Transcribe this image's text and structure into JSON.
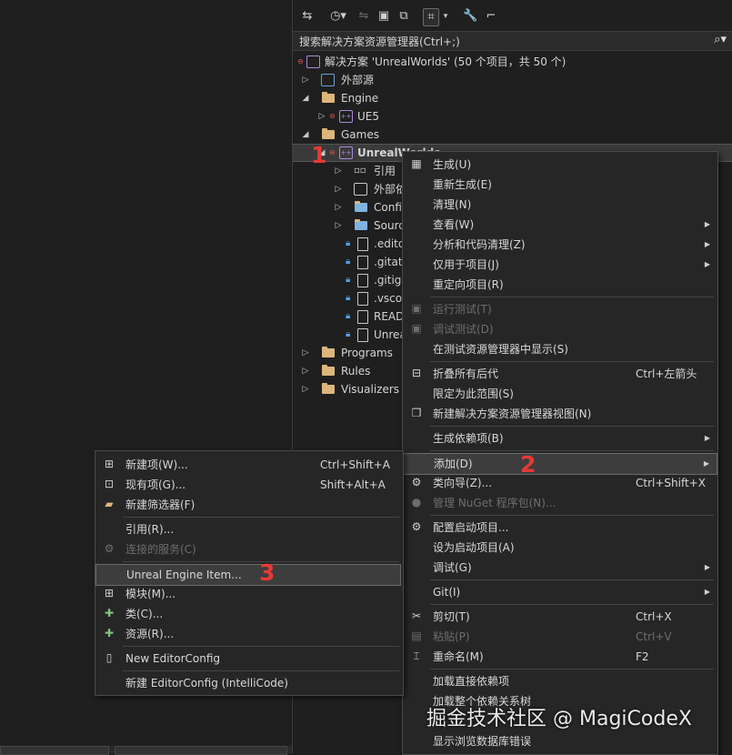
{
  "search": {
    "placeholder": "搜索解决方案资源管理器(Ctrl+;)"
  },
  "solution": {
    "label": "解决方案 'UnrealWorlds' (50 个项目，共 50 个)"
  },
  "tree": {
    "external_sources": "外部源",
    "engine": "Engine",
    "ue5": "UE5",
    "games": "Games",
    "unrealworlds": "UnrealWorlds",
    "references": "引用",
    "external_deps": "外部依",
    "config": "Confi",
    "source": "Sourc",
    "editorconfig": ".edito",
    "gitattributes": ".gitat",
    "gitignore": ".gitig",
    "vscode": ".vsco",
    "readme": "READ",
    "unreal_file": "Unrea",
    "programs": "Programs",
    "rules": "Rules",
    "visualizers": "Visualizers"
  },
  "badges": {
    "b1": "1",
    "b2": "2",
    "b3": "3"
  },
  "context_menu": [
    {
      "label": "生成(U)"
    },
    {
      "label": "重新生成(E)"
    },
    {
      "label": "清理(N)"
    },
    {
      "label": "查看(W)"
    },
    {
      "label": "分析和代码清理(Z)"
    },
    {
      "label": "仅用于项目(J)"
    },
    {
      "label": "重定向项目(R)"
    },
    {
      "label": "运行测试(T)"
    },
    {
      "label": "调试测试(D)"
    },
    {
      "label": "在测试资源管理器中显示(S)"
    },
    {
      "label": "折叠所有后代",
      "shortcut": "Ctrl+左箭头"
    },
    {
      "label": "限定为此范围(S)"
    },
    {
      "label": "新建解决方案资源管理器视图(N)"
    },
    {
      "label": "生成依赖项(B)"
    },
    {
      "label": "添加(D)"
    },
    {
      "label": "类向导(Z)...",
      "shortcut": "Ctrl+Shift+X"
    },
    {
      "label": "管理 NuGet 程序包(N)..."
    },
    {
      "label": "配置启动项目..."
    },
    {
      "label": "设为启动项目(A)"
    },
    {
      "label": "调试(G)"
    },
    {
      "label": "Git(I)"
    },
    {
      "label": "剪切(T)",
      "shortcut": "Ctrl+X"
    },
    {
      "label": "粘贴(P)",
      "shortcut": "Ctrl+V"
    },
    {
      "label": "重命名(M)",
      "shortcut": "F2"
    },
    {
      "label": "加载直接依赖项"
    },
    {
      "label": "加载整个依赖关系树"
    },
    {
      "label": "显示浏览数据库错误"
    }
  ],
  "add_menu": [
    {
      "label": "新建项(W)...",
      "shortcut": "Ctrl+Shift+A"
    },
    {
      "label": "现有项(G)...",
      "shortcut": "Shift+Alt+A"
    },
    {
      "label": "新建筛选器(F)"
    },
    {
      "label": "引用(R)..."
    },
    {
      "label": "连接的服务(C)"
    },
    {
      "label": "Unreal Engine Item..."
    },
    {
      "label": "模块(M)..."
    },
    {
      "label": "类(C)..."
    },
    {
      "label": "资源(R)..."
    },
    {
      "label": "New EditorConfig"
    },
    {
      "label": "新建 EditorConfig (IntelliCode)"
    }
  ],
  "watermark": "掘金技术社区 @ MagiCodeX"
}
